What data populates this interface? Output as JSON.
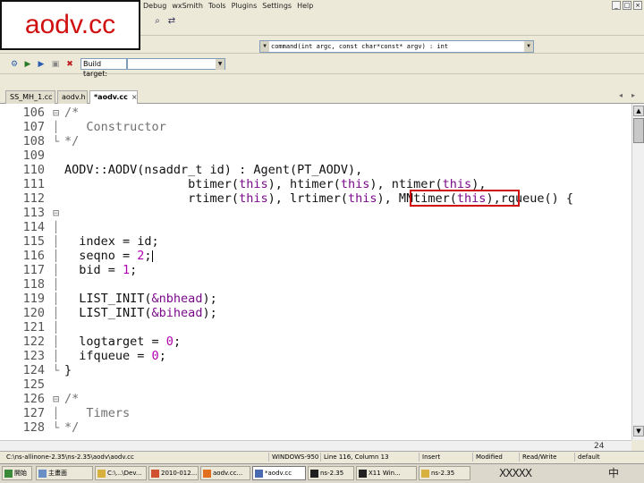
{
  "overlay": {
    "title": "aodv.cc"
  },
  "menu": {
    "items": [
      "Debug",
      "wxSmith",
      "Tools",
      "Plugins",
      "Settings",
      "Help"
    ]
  },
  "window_controls": [
    "_",
    "□",
    "×"
  ],
  "toolbar": {
    "function_signature": "command(int argc, const char*const* argv) : int",
    "build_target_label": "Build target:"
  },
  "tabs": [
    {
      "label": "SS_MH_1.cc",
      "active": false
    },
    {
      "label": "aodv.h",
      "active": false
    },
    {
      "label": "*aodv.cc",
      "active": true
    }
  ],
  "editor": {
    "lines": [
      {
        "n": "106",
        "fold": "⊟",
        "parts": [
          [
            "cm",
            "/*"
          ]
        ]
      },
      {
        "n": "107",
        "fold": "│",
        "parts": [
          [
            "cm",
            "   Constructor"
          ]
        ]
      },
      {
        "n": "108",
        "fold": "└",
        "parts": [
          [
            "cm",
            "*/"
          ]
        ]
      },
      {
        "n": "109",
        "fold": "",
        "parts": []
      },
      {
        "n": "110",
        "fold": "",
        "parts": [
          [
            "t",
            "AODV::AODV(nsaddr_t id) : Agent(PT_AODV),"
          ]
        ]
      },
      {
        "n": "111",
        "fold": "",
        "parts": [
          [
            "t",
            "                 btimer("
          ],
          [
            "kw",
            "this"
          ],
          [
            "t",
            "), htimer("
          ],
          [
            "kw",
            "this"
          ],
          [
            "t",
            "), ntimer("
          ],
          [
            "kw",
            "this"
          ],
          [
            "t",
            "),"
          ]
        ]
      },
      {
        "n": "112",
        "fold": "",
        "parts": [
          [
            "t",
            "                 rtimer("
          ],
          [
            "kw",
            "this"
          ],
          [
            "t",
            "), lrtimer("
          ],
          [
            "kw",
            "this"
          ],
          [
            "t",
            "), MNtimer("
          ],
          [
            "kw",
            "this"
          ],
          [
            "t",
            "),rqueue() {"
          ]
        ]
      },
      {
        "n": "113",
        "fold": "⊟",
        "parts": []
      },
      {
        "n": "114",
        "fold": "│",
        "parts": []
      },
      {
        "n": "115",
        "fold": "│",
        "parts": [
          [
            "t",
            "  index = id;"
          ]
        ]
      },
      {
        "n": "116",
        "fold": "│",
        "parts": [
          [
            "t",
            "  seqno = "
          ],
          [
            "num",
            "2"
          ],
          [
            "t",
            ";"
          ],
          [
            "caret",
            ""
          ]
        ]
      },
      {
        "n": "117",
        "fold": "│",
        "parts": [
          [
            "t",
            "  bid = "
          ],
          [
            "num",
            "1"
          ],
          [
            "t",
            ";"
          ]
        ]
      },
      {
        "n": "118",
        "fold": "│",
        "parts": []
      },
      {
        "n": "119",
        "fold": "│",
        "parts": [
          [
            "t",
            "  LIST_INIT("
          ],
          [
            "sym",
            "&nbhead"
          ],
          [
            "t",
            ");"
          ]
        ]
      },
      {
        "n": "120",
        "fold": "│",
        "parts": [
          [
            "t",
            "  LIST_INIT("
          ],
          [
            "sym",
            "&bihead"
          ],
          [
            "t",
            ");"
          ]
        ]
      },
      {
        "n": "121",
        "fold": "│",
        "parts": []
      },
      {
        "n": "122",
        "fold": "│",
        "parts": [
          [
            "t",
            "  logtarget = "
          ],
          [
            "num",
            "0"
          ],
          [
            "t",
            ";"
          ]
        ]
      },
      {
        "n": "123",
        "fold": "│",
        "parts": [
          [
            "t",
            "  ifqueue = "
          ],
          [
            "num",
            "0"
          ],
          [
            "t",
            ";"
          ]
        ]
      },
      {
        "n": "124",
        "fold": "└",
        "parts": [
          [
            "t",
            "}"
          ]
        ]
      },
      {
        "n": "125",
        "fold": "",
        "parts": []
      },
      {
        "n": "126",
        "fold": "⊟",
        "parts": [
          [
            "cm",
            "/*"
          ]
        ]
      },
      {
        "n": "127",
        "fold": "│",
        "parts": [
          [
            "cm",
            "   Timers"
          ]
        ]
      },
      {
        "n": "128",
        "fold": "└",
        "parts": [
          [
            "cm",
            "*/"
          ]
        ]
      }
    ]
  },
  "page_number": "24",
  "status": {
    "path": "C:\\ns-allinone-2.35\\ns-2.35\\aodv\\aodv.cc",
    "encoding": "WINDOWS-950",
    "position": "Line 116, Column 13",
    "insert": "Insert",
    "modified": "Modified",
    "rw": "Read/Write",
    "default": "default"
  },
  "taskbar": {
    "buttons": [
      "開始",
      "主畫面",
      "C:\\...\\Dev...",
      "2010-012...",
      "aodv.cc...",
      "*aodv.cc",
      "ns-2.35",
      "X11 Win...",
      "ns-2.35"
    ],
    "tray": [
      "ΧΧΧΧΧ",
      "中"
    ]
  }
}
